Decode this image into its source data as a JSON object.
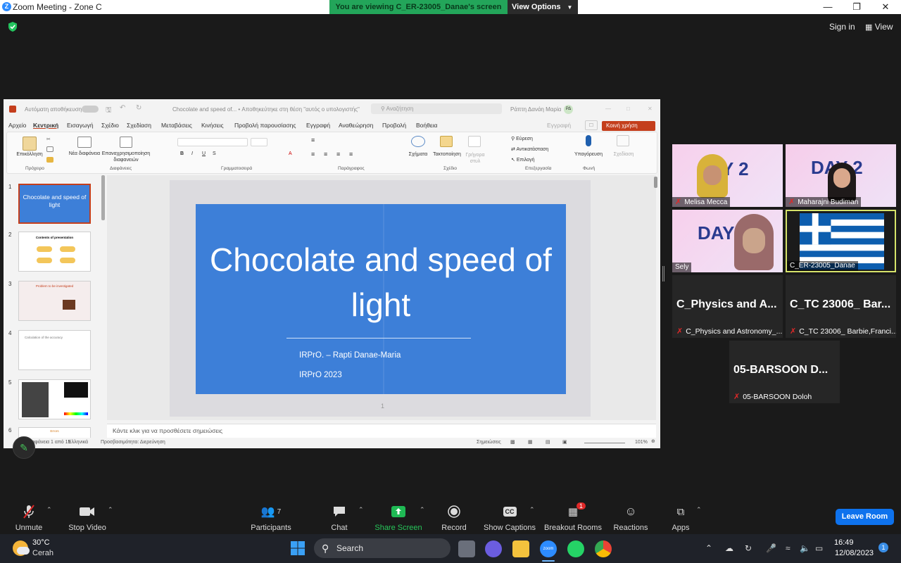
{
  "window": {
    "title": "Zoom Meeting - Zone C",
    "viewing_banner": "You are viewing C_ER-23005_Danae's screen",
    "view_options": "View Options",
    "minimize_icon": "—",
    "maximize_icon": "❐",
    "close_icon": "✕"
  },
  "topbar": {
    "sign_in": "Sign in",
    "view": "View"
  },
  "ppt": {
    "autosave": "Αυτόματη αποθήκευση",
    "doc_title": "Chocolate and speed of... • Αποθηκεύτηκε στη θέση \"αυτός ο υπολογιστής\"",
    "search_placeholder": "Αναζήτηση",
    "user": "Ράπτη Δανάη Μαρία",
    "user_initials": "ΡΔ",
    "record": "Εγγραφή",
    "share": "Κοινή χρήση",
    "menu": [
      "Αρχείο",
      "Κεντρική",
      "Εισαγωγή",
      "Σχέδιο",
      "Σχεδίαση",
      "Μεταβάσεις",
      "Κινήσεις",
      "Προβολή παρουσίασης",
      "Εγγραφή",
      "Αναθεώρηση",
      "Προβολή",
      "Βοήθεια"
    ],
    "ribbon": {
      "paste": "Επικόλληση",
      "new_slide": "Νέα διαφάνεια",
      "reuse": "Επαναχρησιμοποίηση διαφανειών",
      "shapes": "Σχήματα",
      "arrange": "Τακτοποίηση",
      "quick_styles": "Γρήγορα στυλ",
      "find": "Εύρεση",
      "replace": "Αντικατάσταση",
      "select": "Επιλογή",
      "dictate": "Υπαγόρευση",
      "designer": "Σχεδίαση",
      "groups": [
        "Πρόχειρο",
        "Διαφάνειες",
        "Γραμματοσειρά",
        "Παράγραφος",
        "Σχέδιο",
        "Επεξεργασία",
        "Φωνή"
      ]
    },
    "thumb_numbers": [
      "1",
      "2",
      "3",
      "4",
      "5",
      "6"
    ],
    "thumb1_title": "Chocolate and speed of light",
    "thumb2_title": "Contents of presentation",
    "thumb3_title": "Problem to be investigated",
    "thumb4_title": "Calculation of the accuracy",
    "thumb6_title": "Errors",
    "slide": {
      "title": "Chocolate and speed of light",
      "subtitle1": "IRPrO. – Rapti Danae-Maria",
      "subtitle2": "IRPrO 2023",
      "number": "1"
    },
    "notes_placeholder": "Κάντε κλικ για να προσθέσετε σημειώσεις",
    "status": {
      "slide_count": "Διαφάνεια 1 από 15",
      "language": "Ελληνικά",
      "accessibility": "Προσβασιμότητα: Διερεύνηση",
      "notes": "Σημειώσεις",
      "zoom": "101%"
    }
  },
  "participants": [
    {
      "name": "Melisa Mecca",
      "bg": "DAY 2 Judging Session"
    },
    {
      "name": "Maharajni Budiman",
      "bg": "DAY 2 Judging Session"
    },
    {
      "name": "Sely",
      "bg": "DAY 2 Judging Session"
    },
    {
      "name": "C_ER-23005_Danae"
    },
    {
      "title": "C_Physics and A...",
      "name": "C_Physics and Astronomy_..."
    },
    {
      "title": "C_TC 23006_ Bar...",
      "name": "C_TC 23006_ Barbie,Franci..."
    },
    {
      "title": "05-BARSOON D...",
      "name": "05-BARSOON Doloh"
    }
  ],
  "toolbar": {
    "unmute": "Unmute",
    "stop_video": "Stop Video",
    "participants": "Participants",
    "participant_count": "7",
    "chat": "Chat",
    "share_screen": "Share Screen",
    "record": "Record",
    "show_captions": "Show Captions",
    "breakout_rooms": "Breakout Rooms",
    "breakout_badge": "1",
    "reactions": "Reactions",
    "apps": "Apps",
    "leave": "Leave Room",
    "cc": "CC"
  },
  "taskbar": {
    "temperature": "30°C",
    "weather": "Cerah",
    "search": "Search",
    "time": "16:49",
    "date": "12/08/2023",
    "notification_count": "1",
    "zoom_label": "zoom"
  }
}
